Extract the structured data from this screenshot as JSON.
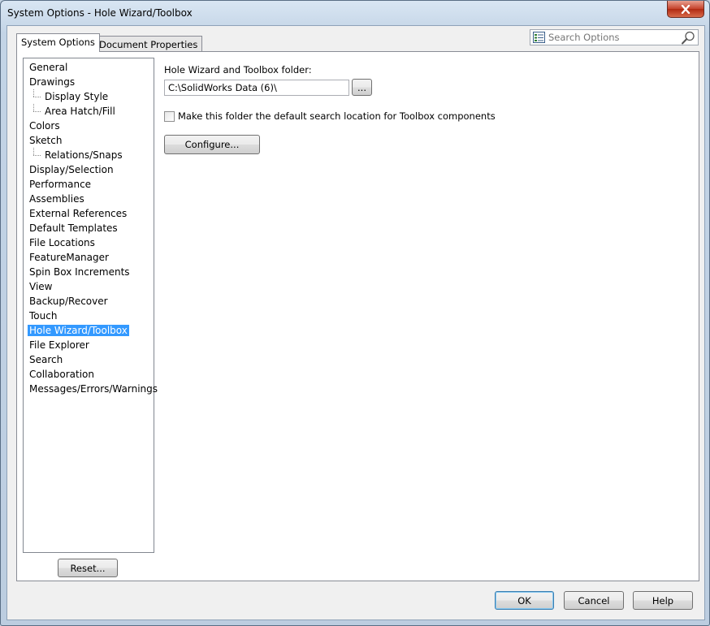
{
  "window": {
    "title": "System Options - Hole Wizard/Toolbox"
  },
  "tabs": [
    {
      "label": "System Options",
      "active": true
    },
    {
      "label": "Document Properties",
      "active": false
    }
  ],
  "search": {
    "placeholder": "Search Options",
    "icon": "magnifier-icon"
  },
  "tree": {
    "items": [
      {
        "label": "General",
        "level": 0
      },
      {
        "label": "Drawings",
        "level": 0
      },
      {
        "label": "Display Style",
        "level": 1
      },
      {
        "label": "Area Hatch/Fill",
        "level": 1
      },
      {
        "label": "Colors",
        "level": 0
      },
      {
        "label": "Sketch",
        "level": 0
      },
      {
        "label": "Relations/Snaps",
        "level": 1
      },
      {
        "label": "Display/Selection",
        "level": 0
      },
      {
        "label": "Performance",
        "level": 0
      },
      {
        "label": "Assemblies",
        "level": 0
      },
      {
        "label": "External References",
        "level": 0
      },
      {
        "label": "Default Templates",
        "level": 0
      },
      {
        "label": "File Locations",
        "level": 0
      },
      {
        "label": "FeatureManager",
        "level": 0
      },
      {
        "label": "Spin Box Increments",
        "level": 0
      },
      {
        "label": "View",
        "level": 0
      },
      {
        "label": "Backup/Recover",
        "level": 0
      },
      {
        "label": "Touch",
        "level": 0
      },
      {
        "label": "Hole Wizard/Toolbox",
        "level": 0,
        "selected": true
      },
      {
        "label": "File Explorer",
        "level": 0
      },
      {
        "label": "Search",
        "level": 0
      },
      {
        "label": "Collaboration",
        "level": 0
      },
      {
        "label": "Messages/Errors/Warnings",
        "level": 0
      }
    ]
  },
  "content": {
    "folder_label": "Hole Wizard and Toolbox folder:",
    "folder_value": "C:\\SolidWorks Data (6)\\",
    "browse_label": "...",
    "checkbox_label": "Make this folder the default search location for Toolbox components",
    "checkbox_checked": false,
    "configure_label": "Configure..."
  },
  "buttons": {
    "reset": "Reset...",
    "ok": "OK",
    "cancel": "Cancel",
    "help": "Help"
  },
  "colors": {
    "selection": "#3399ff",
    "default_button_border": "#3c7fb1"
  }
}
